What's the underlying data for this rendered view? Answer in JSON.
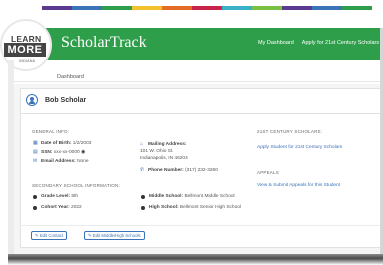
{
  "stripe_colors": [
    "#5b3b8f",
    "#3b73b9",
    "#2e9e4a",
    "#f2c12e",
    "#e56c25",
    "#c8234b",
    "#3bb0c9",
    "#7ac143",
    "#5b3b8f",
    "#3b73b9",
    "#2e9e4a"
  ],
  "logo": {
    "line1": "LEARN",
    "line2": "MORE",
    "line3": "INDIANA"
  },
  "brand": "ScholarTrack",
  "nav": [
    "My Dashboard",
    "Apply for 21st Century Scholars",
    "M"
  ],
  "subnav": {
    "dashboard": "Dashboard"
  },
  "student": {
    "name": "Bob Scholar"
  },
  "general_info": {
    "title": "GENERAL INFO:",
    "dob_label": "Date of Birth:",
    "dob_value": "1/2/2003",
    "ssn_label": "SSN:",
    "ssn_value": "xxx-xx-0000",
    "email_label": "Email Address:",
    "email_value": "None",
    "mailing_label": "Mailing Address:",
    "mailing_line1": "101 W. Ohio St.",
    "mailing_line2": "Indianapolis, IN 46204",
    "phone_label": "Phone Number:",
    "phone_value": "(317) 232-3260"
  },
  "secondary_school": {
    "title": "SECONDARY SCHOOL INFORMATION:",
    "grade_label": "Grade Level:",
    "grade_value": "8th",
    "cohort_label": "Cohort Year:",
    "cohort_value": "2022",
    "middle_label": "Middle School:",
    "middle_value": "Bellmont Middle School",
    "high_label": "High School:",
    "high_value": "Bellmont Senior High School"
  },
  "century": {
    "title": "21ST CENTURY SCHOLARS:",
    "link": "Apply Student for 21st Century Scholars"
  },
  "appeals": {
    "title": "APPEALS",
    "link": "View & Submit Appeals for this Student"
  },
  "buttons": {
    "edit_contact": "Edit Contact",
    "edit_schools": "Edit Middle/High Schools"
  },
  "colors": {
    "nav_green": "#2e9e4a",
    "link_blue": "#3b73b9"
  }
}
